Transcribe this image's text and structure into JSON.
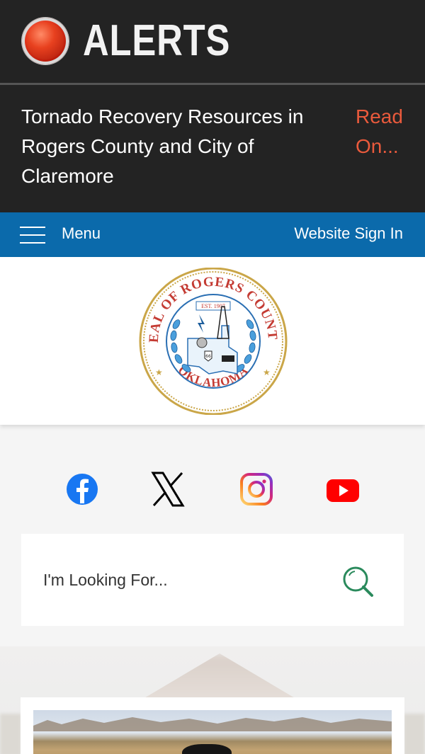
{
  "alerts": {
    "title": "ALERTS",
    "message": "Tornado Recovery Resources in Rogers County and City of Claremore",
    "read_more": "Read On..."
  },
  "nav": {
    "menu_label": "Menu",
    "sign_in": "Website Sign In"
  },
  "seal": {
    "arc_top": "SEAL OF ROGERS COUNTY",
    "arc_bottom": "OKLAHOMA",
    "established": "EST. 1907",
    "route": "66"
  },
  "social": [
    {
      "name": "facebook",
      "icon": "facebook-icon",
      "color": "#1877f2"
    },
    {
      "name": "x",
      "icon": "x-icon",
      "color": "#000000"
    },
    {
      "name": "instagram",
      "icon": "instagram-icon",
      "color": "#c13584"
    },
    {
      "name": "youtube",
      "icon": "youtube-icon",
      "color": "#ff0000"
    }
  ],
  "search": {
    "placeholder": "I'm Looking For..."
  },
  "colors": {
    "alert_bg": "#232323",
    "nav_blue": "#0b6aab",
    "read_on": "#ea5a3c",
    "search_icon": "#2a8a5c"
  }
}
